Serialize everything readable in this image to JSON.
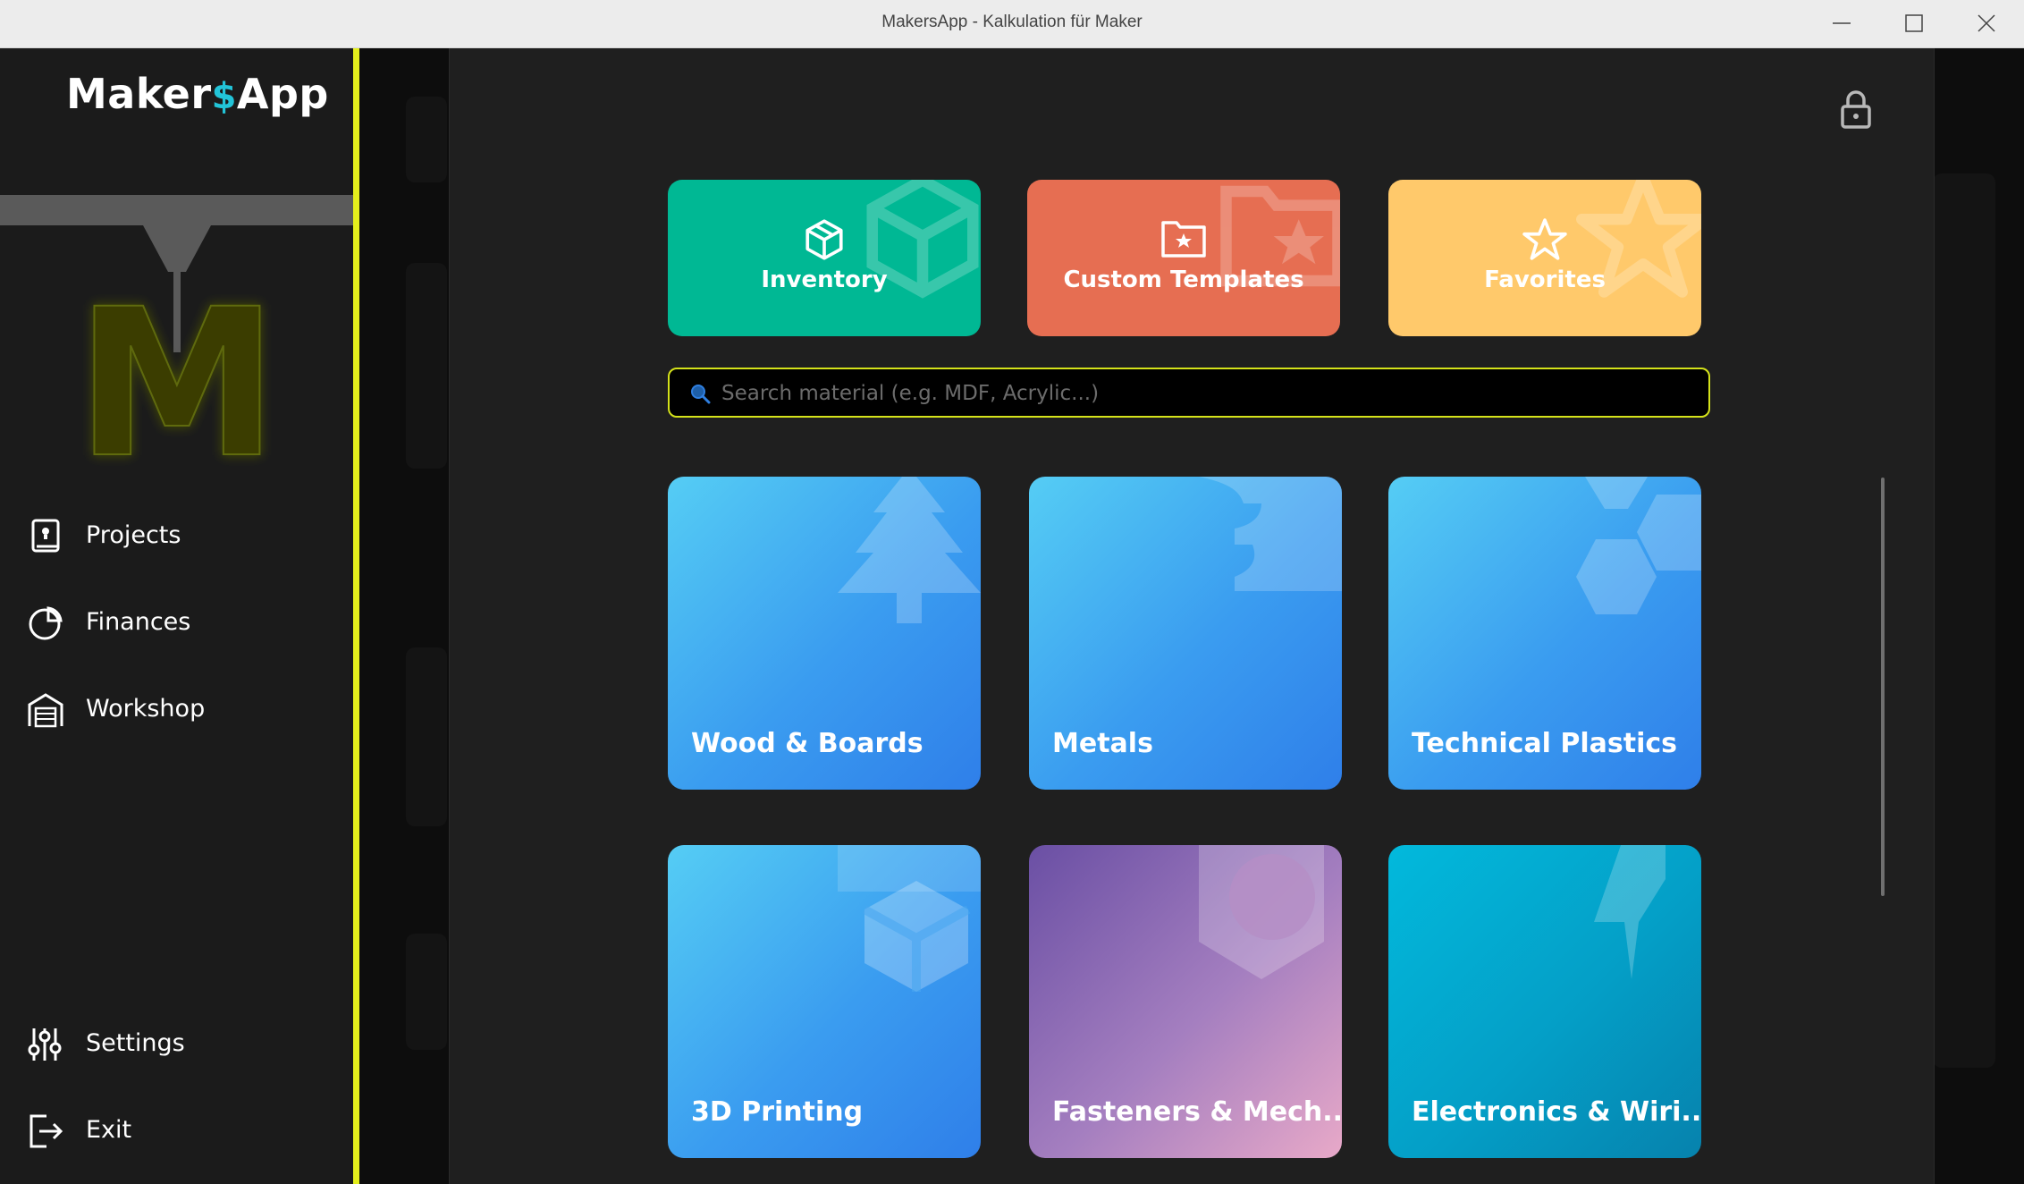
{
  "window": {
    "title": "MakersApp - Kalkulation für Maker",
    "controls": [
      "minimize-icon",
      "maximize-icon",
      "close-icon"
    ]
  },
  "sidebar": {
    "logo": {
      "part1": "Maker",
      "symbol": "$",
      "part2": "App",
      "art_letter": "M"
    },
    "nav_top": [
      {
        "label": "Projects",
        "icon": "project-book-icon"
      },
      {
        "label": "Finances",
        "icon": "pie-chart-icon"
      },
      {
        "label": "Workshop",
        "icon": "garage-icon"
      }
    ],
    "nav_bottom": [
      {
        "label": "Settings",
        "icon": "sliders-icon"
      },
      {
        "label": "Exit",
        "icon": "exit-icon"
      }
    ],
    "accent_color": "#e4ef1c"
  },
  "modal": {
    "lock_icon": "lock-icon",
    "quick_tiles": [
      {
        "label": "Inventory",
        "icon": "box-icon",
        "color": "#00b894"
      },
      {
        "label": "Custom Templates",
        "icon": "folder-star-icon",
        "color": "#e66e52"
      },
      {
        "label": "Favorites",
        "icon": "star-icon",
        "color": "#ffc96b"
      }
    ],
    "search": {
      "placeholder": "Search material (e.g. MDF, Acrylic...)",
      "value": ""
    },
    "categories": [
      {
        "label": "Wood & Boards",
        "icon": "tree-icon"
      },
      {
        "label": "Metals",
        "icon": "anvil-icon"
      },
      {
        "label": "Technical Plastics",
        "icon": "hexagons-icon"
      },
      {
        "label": "3D Printing",
        "icon": "cube-icon"
      },
      {
        "label": "Fasteners & Mech...",
        "icon": "nut-icon"
      },
      {
        "label": "Electronics & Wiri...",
        "icon": "lightning-icon"
      }
    ]
  }
}
